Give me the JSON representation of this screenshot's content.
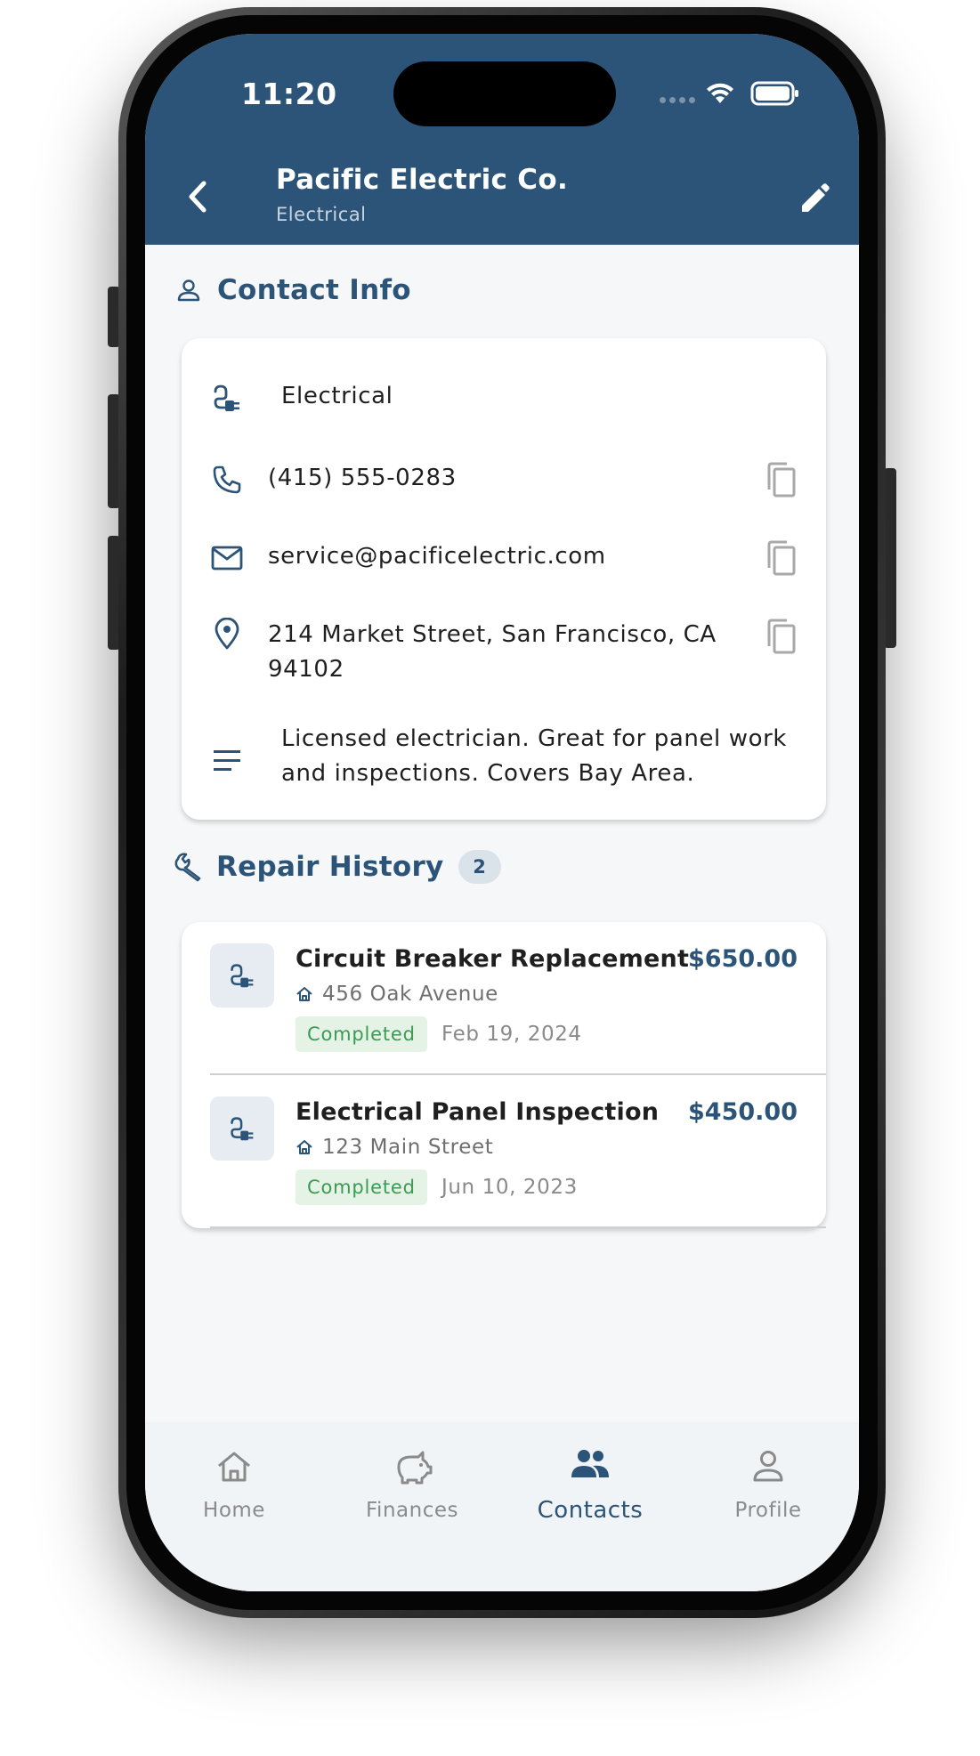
{
  "status_bar": {
    "time": "11:20"
  },
  "header": {
    "title": "Pacific Electric Co.",
    "subtitle": "Electrical"
  },
  "contact_info": {
    "section_title": "Contact Info",
    "category": "Electrical",
    "phone": "(415) 555-0283",
    "email": "service@pacificelectric.com",
    "address_line1": "214 Market Street, San Francisco, CA",
    "address_line2": "94102",
    "notes_line1": "Licensed electrician. Great for panel work",
    "notes_line2": "and inspections. Covers Bay Area."
  },
  "repair_history": {
    "section_title": "Repair History",
    "count": "2",
    "items": [
      {
        "title": "Circuit Breaker Replacement",
        "price": "$650.00",
        "address": "456 Oak Avenue",
        "status": "Completed",
        "date": "Feb 19, 2024"
      },
      {
        "title": "Electrical Panel Inspection",
        "price": "$450.00",
        "address": "123 Main Street",
        "status": "Completed",
        "date": "Jun 10, 2023"
      }
    ]
  },
  "bottom_nav": {
    "items": [
      {
        "label": "Home",
        "icon": "home-icon"
      },
      {
        "label": "Finances",
        "icon": "piggy-bank-icon"
      },
      {
        "label": "Contacts",
        "icon": "people-icon"
      },
      {
        "label": "Profile",
        "icon": "person-icon"
      }
    ],
    "active": "Contacts"
  },
  "colors": {
    "primary": "#2c5478",
    "status_green": "#3c9a52",
    "background": "#f5f7f9"
  }
}
